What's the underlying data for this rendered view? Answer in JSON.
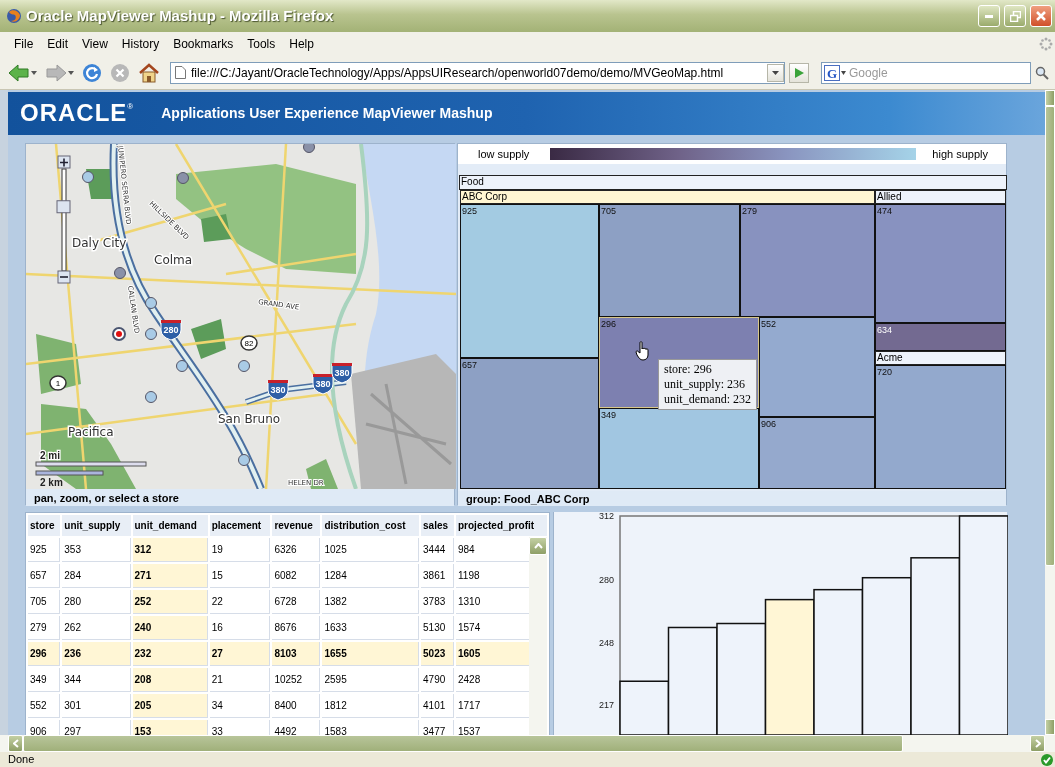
{
  "window": {
    "title": "Oracle MapViewer Mashup - Mozilla Firefox"
  },
  "menu": [
    "File",
    "Edit",
    "View",
    "History",
    "Bookmarks",
    "Tools",
    "Help"
  ],
  "toolbar": {
    "buttons": [
      {
        "kind": "back",
        "disabled": false
      },
      {
        "kind": "forward",
        "disabled": true
      },
      {
        "kind": "reload",
        "disabled": false
      },
      {
        "kind": "stop",
        "disabled": true
      },
      {
        "kind": "home",
        "disabled": false
      }
    ],
    "address": "file:///C:/Jayant/OracleTechnology/Apps/AppsUIResearch/openworld07demo/demo/MVGeoMap.html",
    "search_engine": "G",
    "search_placeholder": "Google"
  },
  "header": {
    "logo": "ORACLE",
    "logo_mark": "®",
    "title": "Applications User Experience MapViewer Mashup"
  },
  "map": {
    "zoom": {
      "level": 0.63
    },
    "labels": [
      {
        "text": "Daly City",
        "kind": "city"
      },
      {
        "text": "Colma",
        "kind": "city"
      },
      {
        "text": "San Bruno",
        "kind": "city"
      },
      {
        "text": "Pacifica",
        "kind": "city"
      },
      {
        "text": "JUNIPERO SERRA BLVD",
        "kind": "street"
      },
      {
        "text": "HILLSIDE BLVD",
        "kind": "street"
      },
      {
        "text": "CALLAN BLVD",
        "kind": "street"
      },
      {
        "text": "GRAND AVE",
        "kind": "street"
      },
      {
        "text": "HELEN DR",
        "kind": "street"
      }
    ],
    "shields": [
      {
        "text": "280",
        "kind": "interstate"
      },
      {
        "text": "82",
        "kind": "state"
      },
      {
        "text": "1",
        "kind": "state"
      },
      {
        "text": "380",
        "kind": "interstate"
      },
      {
        "text": "380",
        "kind": "interstate"
      },
      {
        "text": "380",
        "kind": "interstate"
      }
    ],
    "stores": [
      {
        "selected": false,
        "color": "#a9cbe6"
      },
      {
        "selected": false,
        "color": "#8a91a8"
      },
      {
        "selected": false,
        "color": "#8a91a8"
      },
      {
        "selected": false,
        "color": "#8a91a8"
      },
      {
        "selected": false,
        "color": "#a9cbe6"
      },
      {
        "selected": false,
        "color": "#a9cbe6"
      },
      {
        "selected": true,
        "color": "#e01010"
      },
      {
        "selected": false,
        "color": "#a9cbe6"
      },
      {
        "selected": false,
        "color": "#a9cbe6"
      },
      {
        "selected": false,
        "color": "#a9cbe6"
      },
      {
        "selected": false,
        "color": "#a9cbe6"
      }
    ],
    "scale": [
      "2 mi",
      "2 km"
    ],
    "footer": "pan, zoom, or select a store"
  },
  "treemap": {
    "legend": {
      "low": "low supply",
      "high": "high supply"
    },
    "headers": [
      {
        "label": "Food",
        "selected": false
      },
      {
        "label": "ABC Corp",
        "selected": true
      },
      {
        "label": "Allied",
        "selected": false
      },
      {
        "label": "Acme",
        "selected": false
      }
    ],
    "tiles": [
      {
        "label": "925",
        "color": "#a3cbe2",
        "selected": false
      },
      {
        "label": "657",
        "color": "#8da0c4",
        "selected": false
      },
      {
        "label": "705",
        "color": "#8da0c4",
        "selected": false
      },
      {
        "label": "279",
        "color": "#8892bf",
        "selected": false
      },
      {
        "label": "296",
        "color": "#7d80b0",
        "selected": true
      },
      {
        "label": "349",
        "color": "#a1c6e1",
        "selected": false
      },
      {
        "label": "552",
        "color": "#94aacf",
        "selected": false
      },
      {
        "label": "906",
        "color": "#95a9cd",
        "selected": false
      },
      {
        "label": "474",
        "color": "#8892c0",
        "selected": false
      },
      {
        "label": "634",
        "color": "#736a91",
        "selected": false
      },
      {
        "label": "720",
        "color": "#93a9cd",
        "selected": false
      }
    ],
    "tooltip": [
      "store: 296",
      "unit_supply: 236",
      "unit_demand: 232"
    ],
    "footer": "group: Food_ABC Corp"
  },
  "table": {
    "columns": [
      {
        "label": "store",
        "highlighted": false
      },
      {
        "label": "unit_supply",
        "highlighted": false
      },
      {
        "label": "unit_demand",
        "highlighted": true
      },
      {
        "label": "placement",
        "highlighted": false
      },
      {
        "label": "revenue",
        "highlighted": false
      },
      {
        "label": "distribution_cost",
        "highlighted": false
      },
      {
        "label": "sales",
        "highlighted": false
      },
      {
        "label": "projected_profit",
        "highlighted": false
      }
    ],
    "rows": [
      {
        "selected": false,
        "cells": [
          "925",
          "353",
          "312",
          "19",
          "6326",
          "1025",
          "3444",
          "984"
        ]
      },
      {
        "selected": false,
        "cells": [
          "657",
          "284",
          "271",
          "15",
          "6082",
          "1284",
          "3861",
          "1198"
        ]
      },
      {
        "selected": false,
        "cells": [
          "705",
          "280",
          "252",
          "22",
          "6728",
          "1382",
          "3783",
          "1310"
        ]
      },
      {
        "selected": false,
        "cells": [
          "279",
          "262",
          "240",
          "16",
          "8676",
          "1633",
          "5130",
          "1574"
        ]
      },
      {
        "selected": true,
        "cells": [
          "296",
          "236",
          "232",
          "27",
          "8103",
          "1655",
          "5023",
          "1605"
        ]
      },
      {
        "selected": false,
        "cells": [
          "349",
          "344",
          "208",
          "21",
          "10252",
          "2595",
          "4790",
          "2428"
        ]
      },
      {
        "selected": false,
        "cells": [
          "552",
          "301",
          "205",
          "34",
          "8400",
          "1812",
          "4101",
          "1717"
        ]
      },
      {
        "selected": false,
        "cells": [
          "906",
          "297",
          "153",
          "33",
          "4492",
          "1583",
          "3477",
          "1537"
        ]
      }
    ]
  },
  "chart": {
    "bars": [
      {
        "selected": false
      },
      {
        "selected": false
      },
      {
        "selected": false
      },
      {
        "selected": true
      },
      {
        "selected": false
      },
      {
        "selected": false
      },
      {
        "selected": false
      },
      {
        "selected": false
      }
    ],
    "chart_data": {
      "type": "bar",
      "categories": [
        null,
        null,
        null,
        null,
        null,
        null,
        null,
        null
      ],
      "values": [
        229,
        256,
        258,
        270,
        275,
        281,
        291,
        312
      ],
      "ylim": [
        202,
        312
      ],
      "yticks": [
        {
          "value": 217,
          "label": "217"
        },
        {
          "value": 248,
          "label": "248"
        },
        {
          "value": 280,
          "label": "280"
        },
        {
          "value": 312,
          "label": "312"
        }
      ]
    }
  },
  "status_bar": "Done"
}
